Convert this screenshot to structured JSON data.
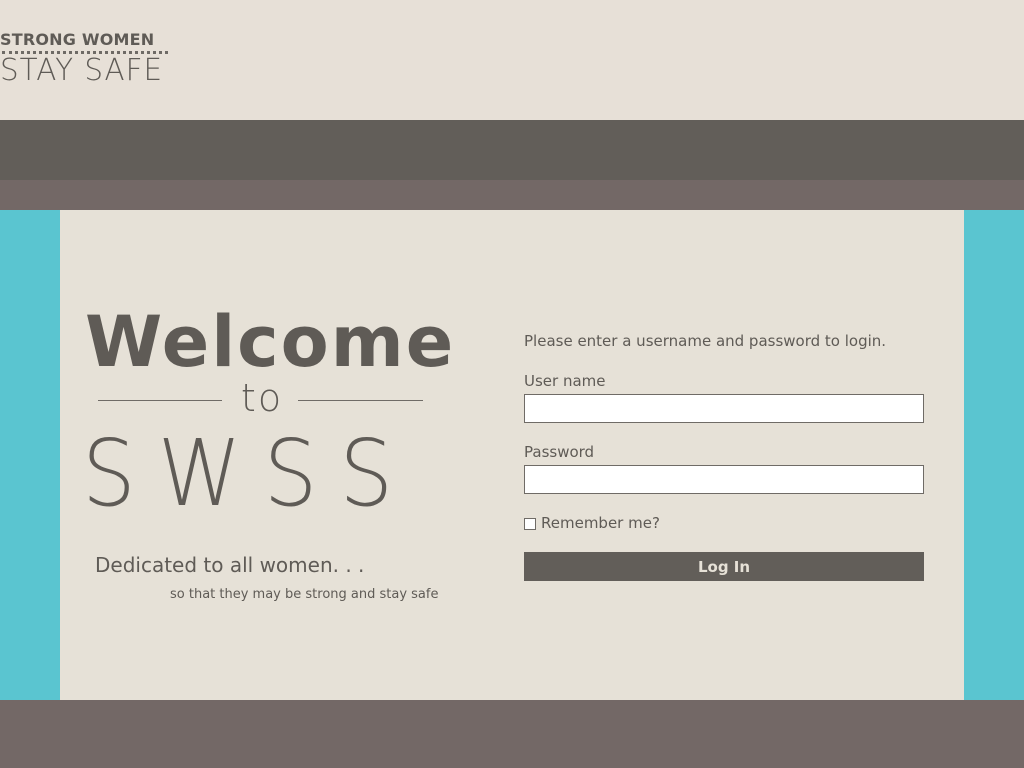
{
  "header": {
    "logo": {
      "line1": "STRONG WOMEN",
      "line2": "STAY SAFE"
    }
  },
  "hero": {
    "welcome": "Welcome",
    "to": "to",
    "brand": "SWSS",
    "tagline": "Dedicated to all women. . .",
    "subtagline": "so that they may be strong and stay safe"
  },
  "login": {
    "intro": "Please enter a username and password to login.",
    "username_label": "User name",
    "username_value": "",
    "password_label": "Password",
    "password_value": "",
    "remember_label": "Remember me?",
    "remember_checked": false,
    "submit_label": "Log In"
  },
  "colors": {
    "header_bg": "#e7e0d7",
    "nav_bg": "#625e59",
    "frame_bg": "#736866",
    "accent_teal": "#5ac5d0",
    "content_bg": "#e6e1d7",
    "text": "#5f5b56",
    "button_text": "#e6e1d7"
  }
}
